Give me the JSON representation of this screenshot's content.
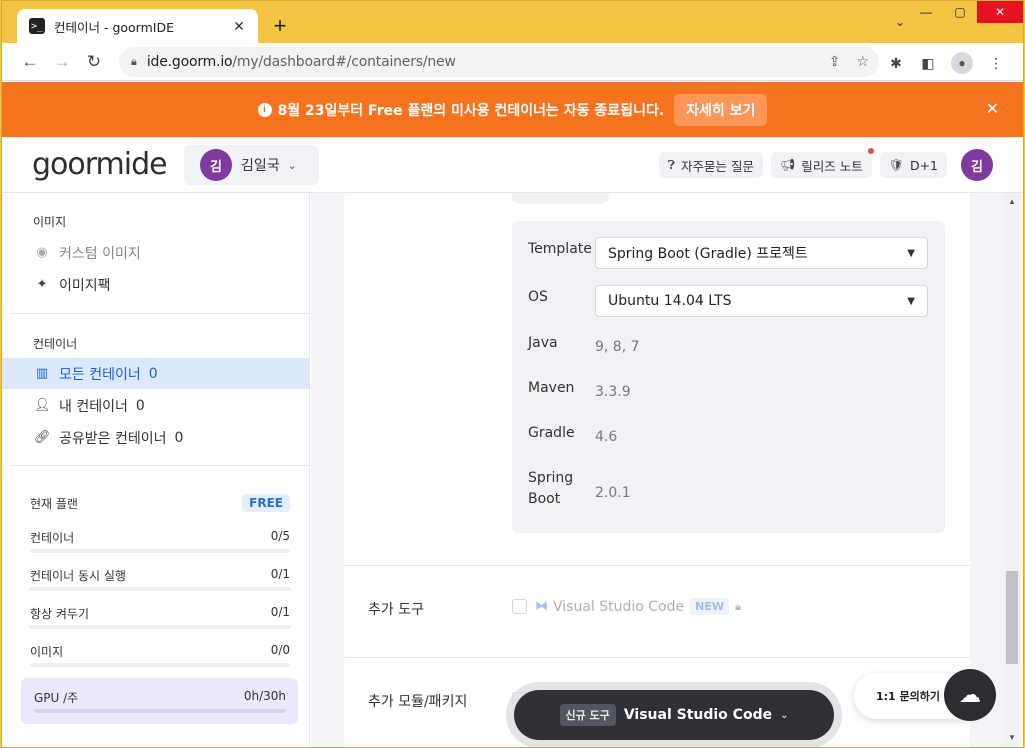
{
  "browser": {
    "tab_title": "컨테이너 - goormIDE",
    "tab_favicon": ">_",
    "url_domain": "ide.goorm.io",
    "url_path": "/my/dashboard#/containers/new"
  },
  "banner": {
    "text": "8월 23일부터 Free 플랜의 미사용 컨테이너는 자동 종료됩니다.",
    "button_label": "자세히 보기"
  },
  "header": {
    "logo": "goormide",
    "user_initial": "김",
    "user_name": "김일국",
    "faq_label": "자주묻는 질문",
    "release_label": "릴리즈 노트",
    "dday_label": "D+1",
    "avatar_initial": "김"
  },
  "sidebar": {
    "image_section": "이미지",
    "custom_image": "커스텀 이미지",
    "image_pack": "이미지팩",
    "container_section": "컨테이너",
    "all_containers": "모든 컨테이너",
    "all_count": "0",
    "my_containers": "내 컨테이너",
    "my_count": "0",
    "shared_containers": "공유받은 컨테이너",
    "shared_count": "0",
    "plan": {
      "title": "현재 플랜",
      "badge": "FREE",
      "rows": [
        {
          "label": "컨테이너",
          "value": "0/5"
        },
        {
          "label": "컨테이너 동시 실행",
          "value": "0/1"
        },
        {
          "label": "항상 켜두기",
          "value": "0/1"
        },
        {
          "label": "이미지",
          "value": "0/0"
        }
      ],
      "gpu_label": "GPU /주",
      "gpu_value": "0h/30h"
    }
  },
  "stack": {
    "template_label": "Template",
    "template_value": "Spring Boot (Gradle) 프로젝트",
    "os_label": "OS",
    "os_value": "Ubuntu 14.04 LTS",
    "java_label": "Java",
    "java_value": "9, 8, 7",
    "maven_label": "Maven",
    "maven_value": "3.3.9",
    "gradle_label": "Gradle",
    "gradle_value": "4.6",
    "spring_label_1": "Spring",
    "spring_label_2": "Boot",
    "spring_value": "2.0.1"
  },
  "extra_tools": {
    "label": "추가 도구",
    "vscode_label": "Visual Studio Code",
    "new_badge": "NEW"
  },
  "modules": {
    "label": "추가 모듈/패키지"
  },
  "floating": {
    "badge": "신규 도구",
    "text": "Visual Studio Code",
    "chat_label": "1:1 문의하기"
  },
  "colors": {
    "banner": "#f5731f",
    "accent": "#1b5fcf",
    "avatar": "#7e3a9d"
  }
}
